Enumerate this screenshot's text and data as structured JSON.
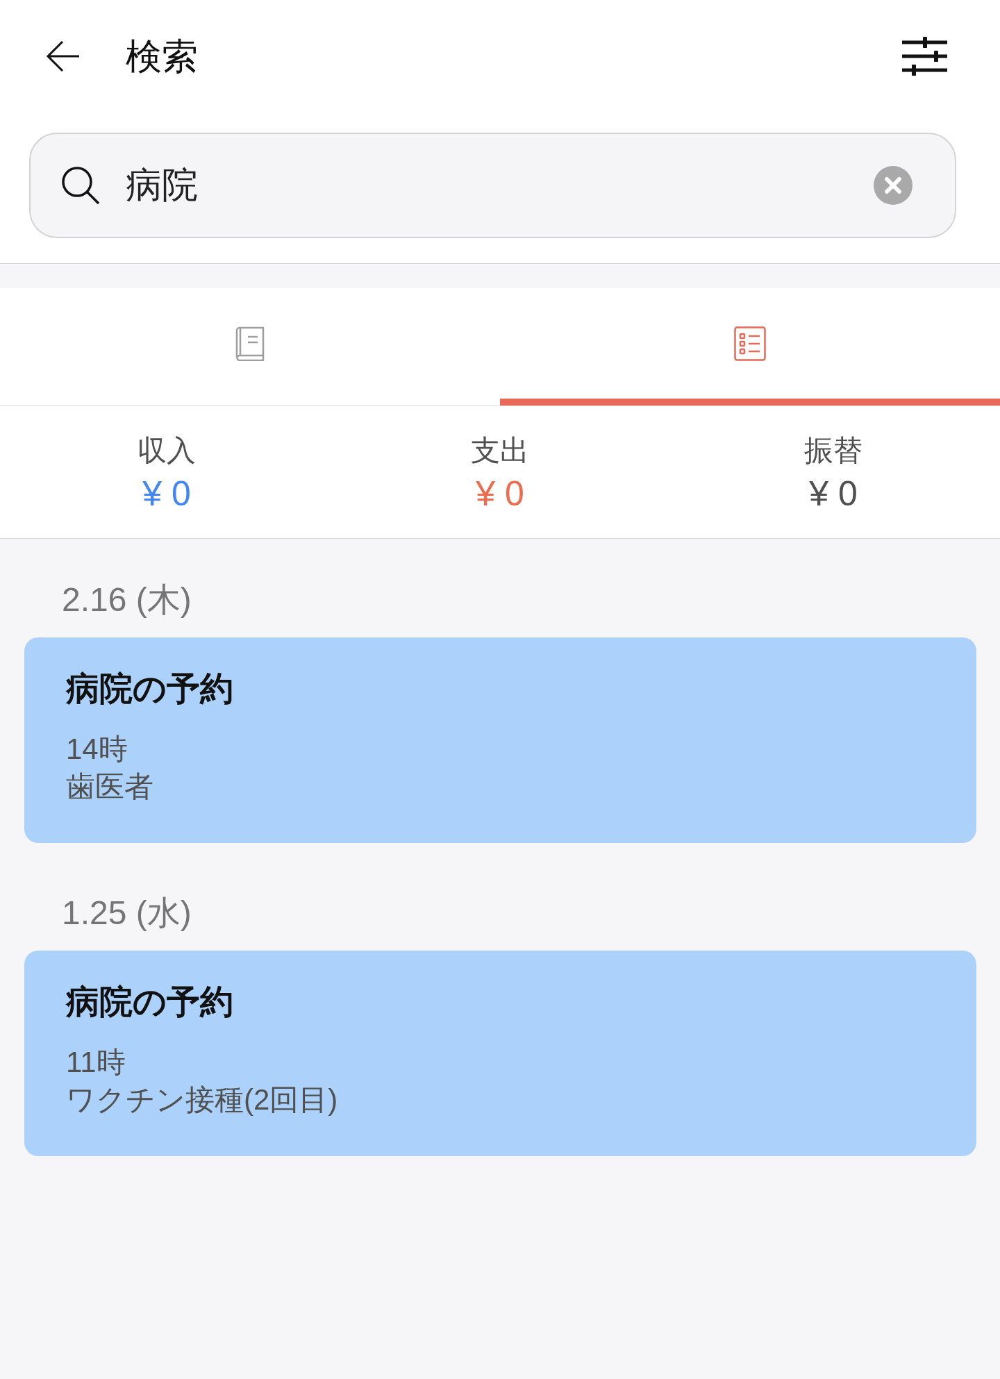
{
  "header": {
    "title": "検索"
  },
  "search": {
    "value": "病院"
  },
  "tabs": [
    {
      "kind": "book",
      "selected": false
    },
    {
      "kind": "list",
      "selected": true
    }
  ],
  "summary": [
    {
      "label": "収入",
      "amount": "¥ 0",
      "color": "#4285f4"
    },
    {
      "label": "支出",
      "amount": "¥ 0",
      "color": "#ee6b4d"
    },
    {
      "label": "振替",
      "amount": "¥ 0",
      "color": "#505050"
    }
  ],
  "groups": [
    {
      "date": "2.16 (木)",
      "items": [
        {
          "title": "病院の予約",
          "lines": [
            "14時",
            "歯医者"
          ]
        }
      ]
    },
    {
      "date": "1.25 (水)",
      "items": [
        {
          "title": "病院の予約",
          "lines": [
            "11時",
            "ワクチン接種(2回目)"
          ]
        }
      ]
    }
  ]
}
